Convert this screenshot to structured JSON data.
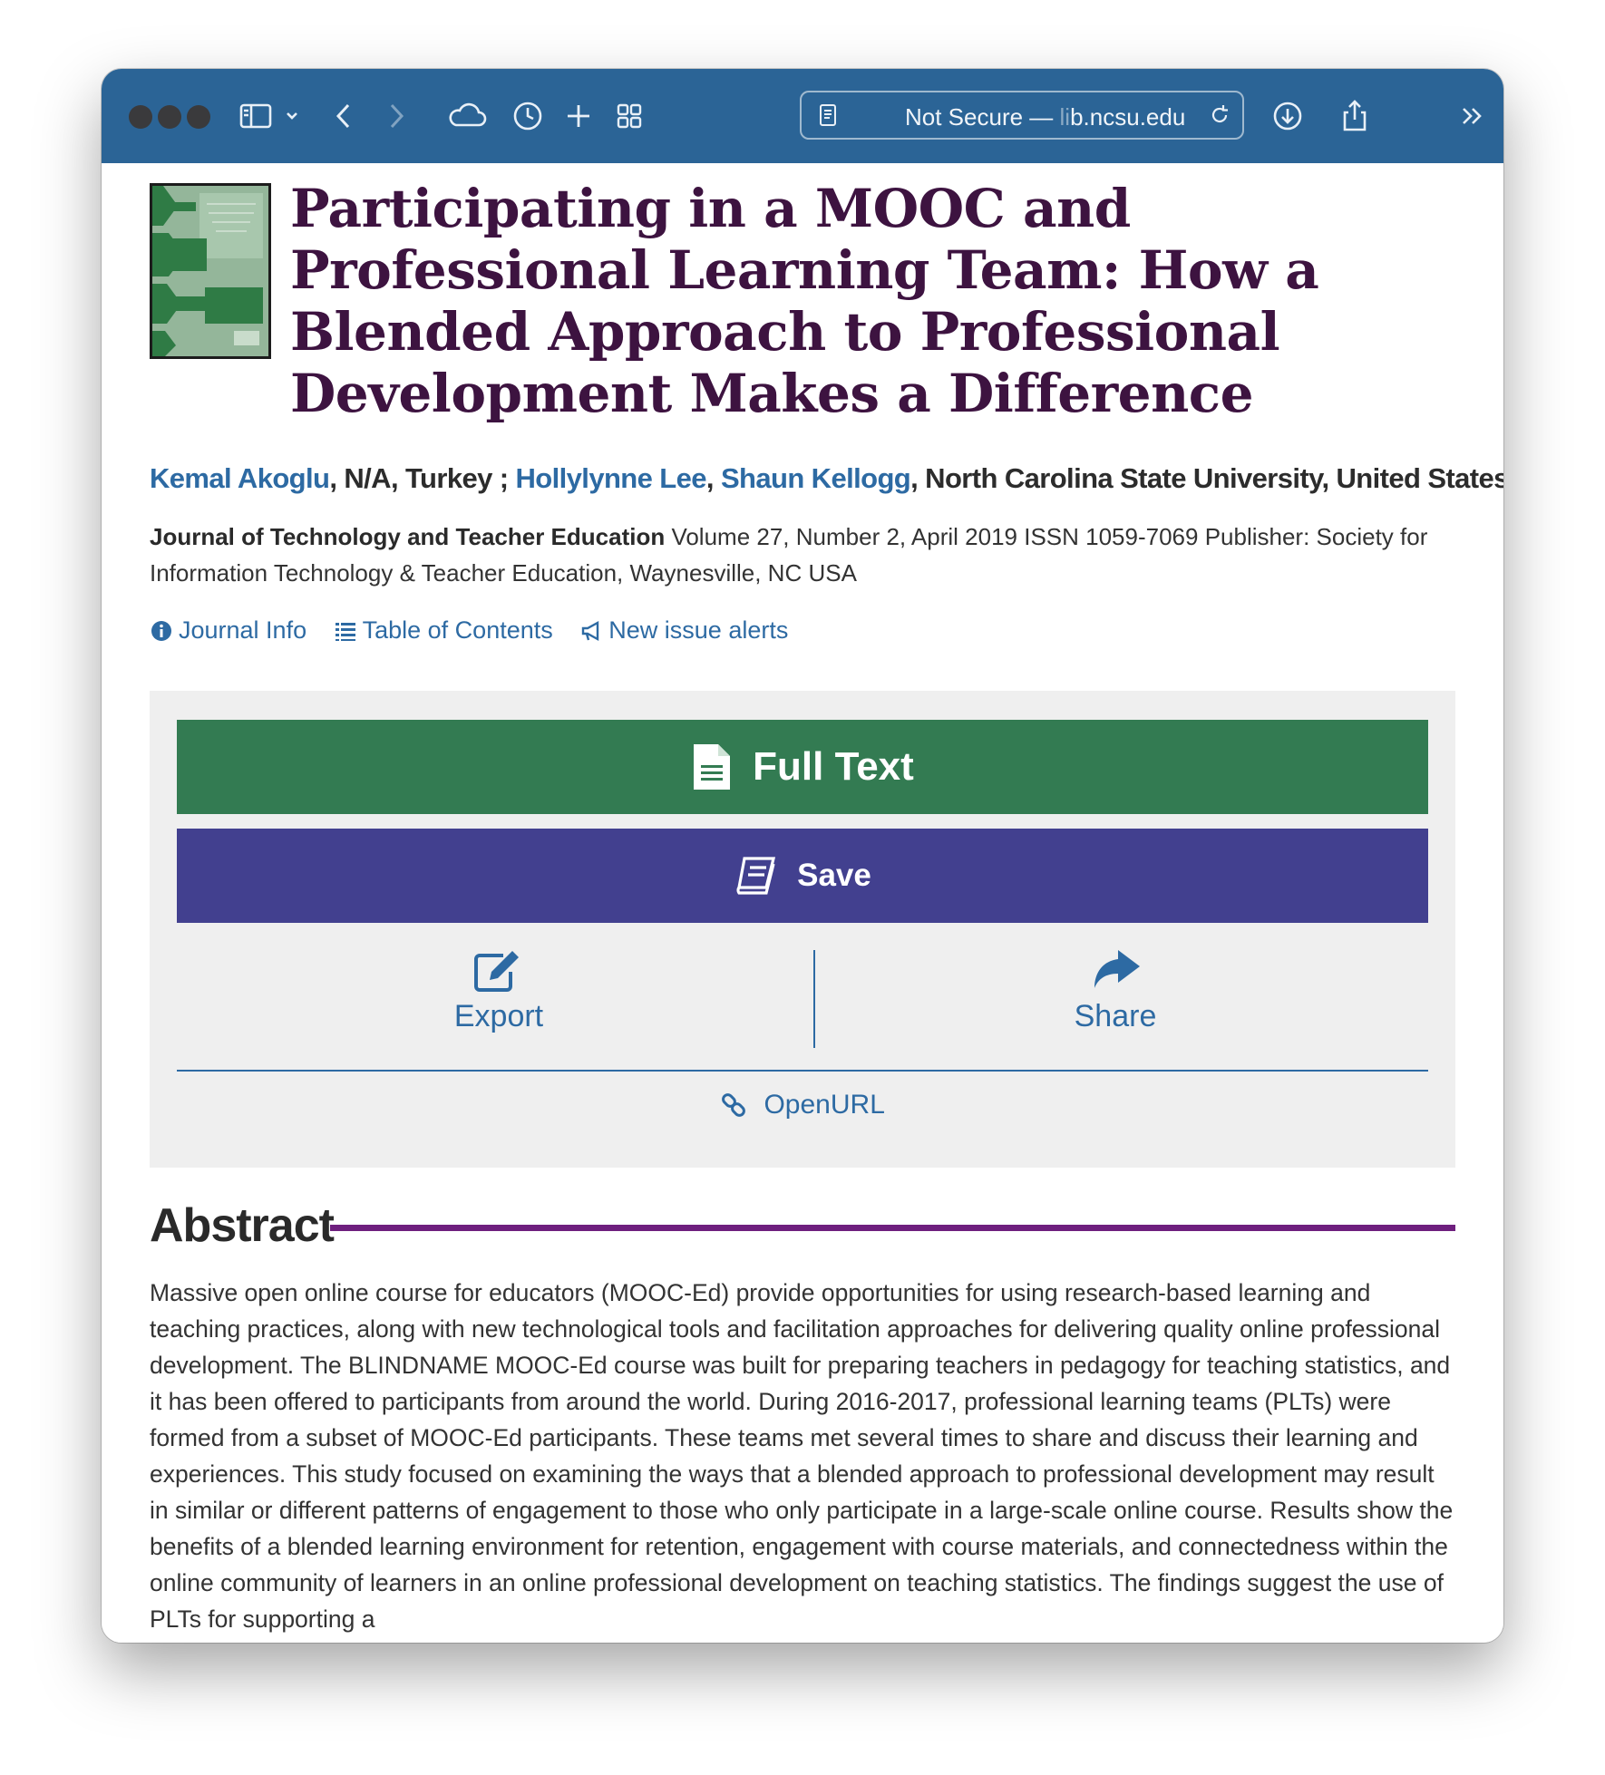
{
  "browser": {
    "address": {
      "security": "Not Secure —",
      "host_fade": "li",
      "host": "b.ncsu.edu"
    }
  },
  "article": {
    "title": "Participating in a MOOC and Professional Learning Team: How a Blended Approach to Professional Development Makes a Difference",
    "authors": {
      "a1": "Kemal Akoglu",
      "a1_affil": ", N/A, Turkey ; ",
      "a2": "Hollylynne Lee",
      "sep": ", ",
      "a3": "Shaun Kellogg",
      "a3_affil": ", North Carolina State University, United States"
    },
    "journal": {
      "name": "Journal of Technology and Teacher Education",
      "details": " Volume 27, Number 2, April 2019 ISSN 1059-7069 Publisher: Society for Information Technology & Teacher Education, Waynesville, NC USA"
    },
    "links": {
      "journal_info": "Journal Info",
      "toc": "Table of Contents",
      "alerts": "New issue alerts"
    }
  },
  "actions": {
    "full_text": "Full Text",
    "save": "Save",
    "export": "Export",
    "share": "Share",
    "openurl": "OpenURL"
  },
  "abstract": {
    "heading": "Abstract",
    "text": "Massive open online course for educators (MOOC-Ed) provide opportunities for using research-based learning and teaching practices, along with new technological tools and facilitation approaches for delivering quality online professional development. The BLINDNAME MOOC-Ed course was built for preparing teachers in pedagogy for teaching statistics, and it has been offered to participants from around the world. During 2016-2017, professional learning teams (PLTs) were formed from a subset of MOOC-Ed participants. These teams met several times to share and discuss their learning and experiences. This study focused on examining the ways that a blended approach to professional development may result in similar or different patterns of engagement to those who only participate in a large-scale online course. Results show the benefits of a blended learning environment for retention, engagement with course materials, and connectedness within the online community of learners in an online professional development on teaching statistics. The findings suggest the use of PLTs for supporting a"
  },
  "colors": {
    "toolbar": "#2b6496",
    "title": "#3d1340",
    "link": "#2d6aa3",
    "full_text_btn": "#337b52",
    "save_btn": "#42408f",
    "abstract_rule": "#6e1f7e"
  }
}
